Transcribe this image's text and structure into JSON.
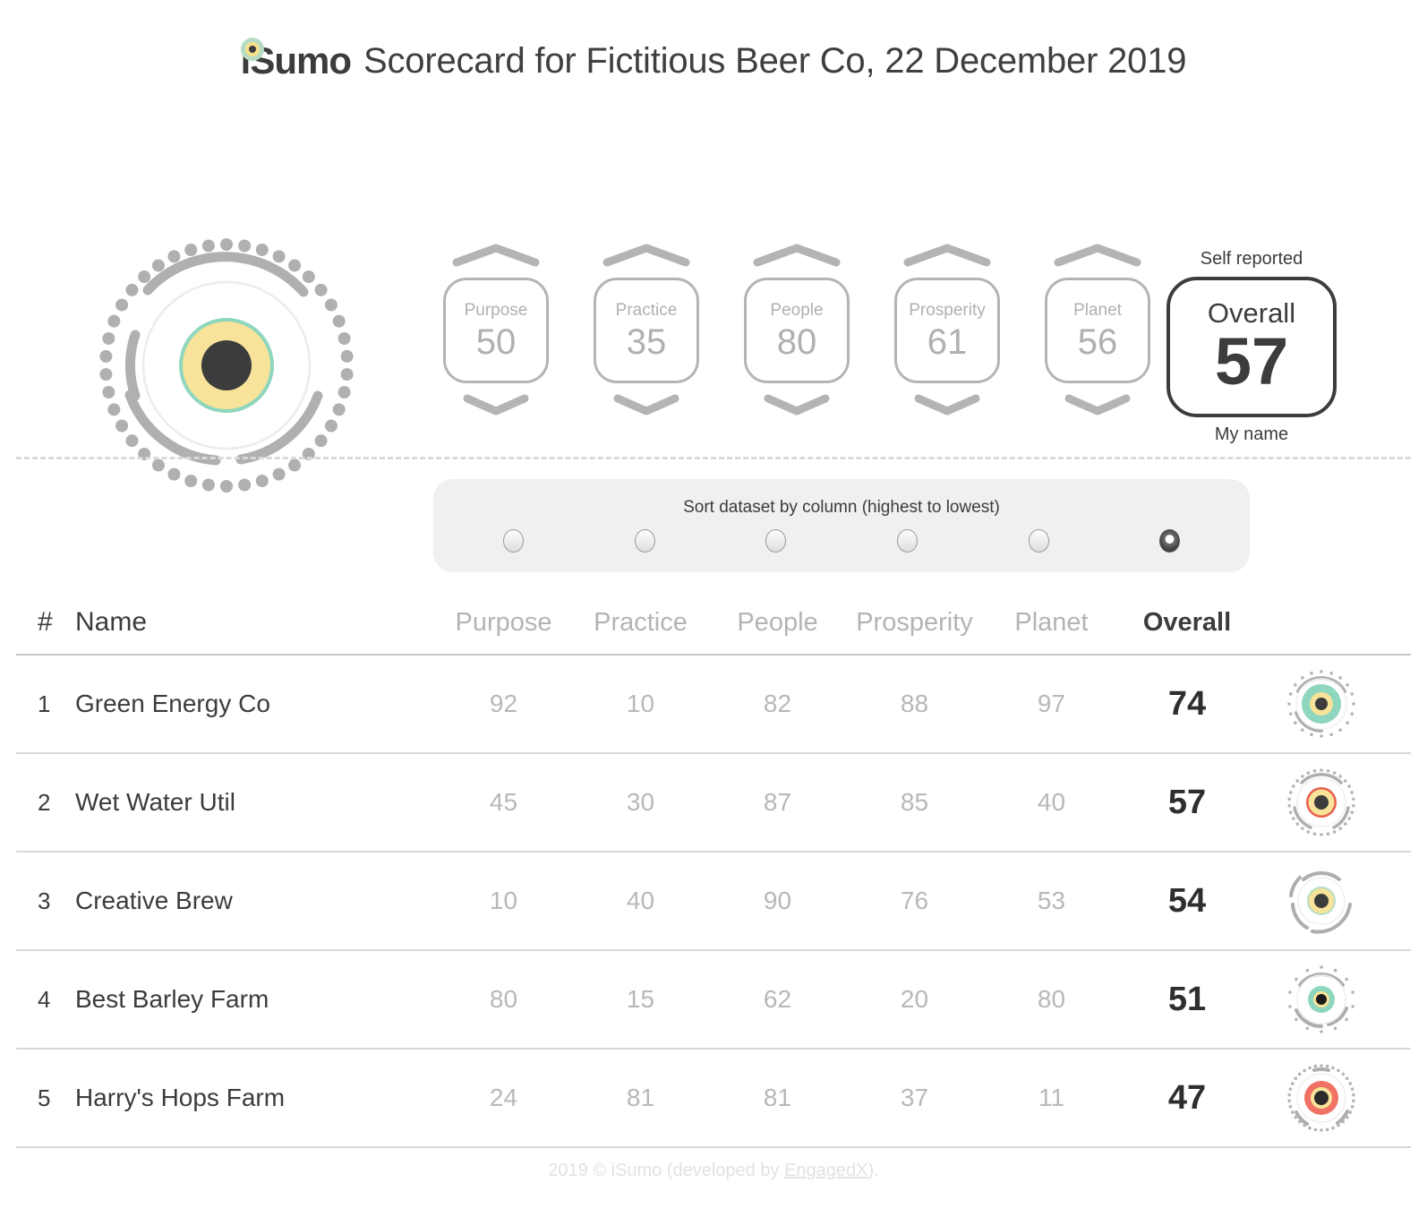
{
  "header": {
    "brand": "iSumo",
    "title_rest": "Scorecard for Fictitious Beer Co, 22 December 2019",
    "brand_dot_icon": "isumo-eye-icon"
  },
  "logo": {
    "icon": "isumo-scorecard-dial-icon",
    "ring_color": "#8ed6bd",
    "mid_color": "#f8e39a",
    "core_color": "#3c3c3c",
    "dot_ring_color": "#b0b0b0"
  },
  "metrics": [
    {
      "label": "Purpose",
      "value": "50",
      "up_icon": "chevron-up-icon",
      "down_icon": "chevron-down-icon"
    },
    {
      "label": "Practice",
      "value": "35",
      "up_icon": "chevron-up-icon",
      "down_icon": "chevron-down-icon"
    },
    {
      "label": "People",
      "value": "80",
      "up_icon": "chevron-up-icon",
      "down_icon": "chevron-down-icon"
    },
    {
      "label": "Prosperity",
      "value": "61",
      "up_icon": "chevron-up-icon",
      "down_icon": "chevron-down-icon"
    },
    {
      "label": "Planet",
      "value": "56",
      "up_icon": "chevron-up-icon",
      "down_icon": "chevron-down-icon"
    }
  ],
  "overall": {
    "top_label": "Self reported",
    "label": "Overall",
    "value": "57",
    "bottom_label": "My name"
  },
  "sort": {
    "title": "Sort dataset by column (highest to lowest)",
    "options": [
      "Purpose",
      "Practice",
      "People",
      "Prosperity",
      "Planet",
      "Overall"
    ],
    "selected_index": 5
  },
  "table": {
    "headers": {
      "rank": "#",
      "name": "Name",
      "metrics": [
        "Purpose",
        "Practice",
        "People",
        "Prosperity",
        "Planet"
      ],
      "overall": "Overall"
    },
    "rows": [
      {
        "rank": "1",
        "name": "Green Energy Co",
        "metrics": [
          "92",
          "10",
          "82",
          "88",
          "97"
        ],
        "overall": "74",
        "icon": "score-dial-icon",
        "icon_colors": {
          "outer": "#8ed6bd",
          "mid": "#f8e39a",
          "core": "#3c3c3c"
        }
      },
      {
        "rank": "2",
        "name": "Wet Water Util",
        "metrics": [
          "45",
          "30",
          "87",
          "85",
          "40"
        ],
        "overall": "57",
        "icon": "score-dial-icon",
        "icon_colors": {
          "outer": "#e8604c",
          "mid": "#f8e39a",
          "core": "#3c3c3c"
        }
      },
      {
        "rank": "3",
        "name": "Creative Brew",
        "metrics": [
          "10",
          "40",
          "90",
          "76",
          "53"
        ],
        "overall": "54",
        "icon": "score-dial-icon",
        "icon_colors": {
          "outer": "#b6ddc3",
          "mid": "#f8e39a",
          "core": "#3c3c3c"
        }
      },
      {
        "rank": "4",
        "name": "Best Barley Farm",
        "metrics": [
          "80",
          "15",
          "62",
          "20",
          "80"
        ],
        "overall": "51",
        "icon": "score-dial-icon",
        "icon_colors": {
          "outer": "#8ed6bd",
          "mid": "#f8e39a",
          "core": "#1c1c1c"
        }
      },
      {
        "rank": "5",
        "name": "Harry's Hops Farm",
        "metrics": [
          "24",
          "81",
          "81",
          "37",
          "11"
        ],
        "overall": "47",
        "icon": "score-dial-icon",
        "icon_colors": {
          "outer": "#ef7264",
          "mid": "#f8e39a",
          "core": "#3c3c3c"
        }
      }
    ]
  },
  "footer": {
    "prefix": "2019 © iSumo (developed by ",
    "link": "EngagedX",
    "suffix": ")."
  }
}
